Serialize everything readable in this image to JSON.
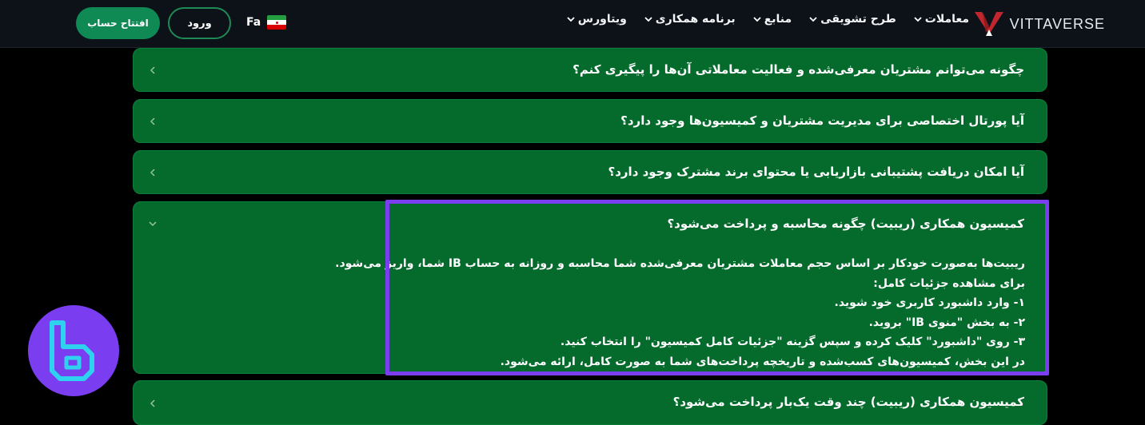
{
  "header": {
    "brand_name": "VITTAVERSE",
    "nav": [
      {
        "label": "معاملات"
      },
      {
        "label": "طرح تشویقی"
      },
      {
        "label": "منابع"
      },
      {
        "label": "برنامه همکاری"
      },
      {
        "label": "ویتاورس"
      }
    ],
    "language": "Fa",
    "login_label": "ورود",
    "open_account_label": "افتتاح حساب"
  },
  "faq": {
    "items": [
      {
        "question": "چگونه می‌توانم مشتریان معرفی‌شده و فعالیت معاملاتی آن‌ها را پیگیری کنم؟",
        "expanded": false
      },
      {
        "question": "آیا پورتال اختصاصی برای مدیریت مشتریان و کمیسیون‌ها وجود دارد؟",
        "expanded": false
      },
      {
        "question": "آیا امکان دریافت پشتیبانی بازاریابی یا محتوای برند مشترک وجود دارد؟",
        "expanded": false
      },
      {
        "question": "کمیسیون همکاری (ریبیت) چگونه محاسبه و پرداخت می‌شود؟",
        "expanded": true
      },
      {
        "question": "کمیسیون همکاری (ریبیت) چند وقت یک‌بار پرداخت می‌شود؟",
        "expanded": false
      }
    ],
    "answer_lines": [
      "ریبیت‌ها به‌صورت خودکار بر اساس حجم معاملات مشتریان معرفی‌شده شما محاسبه و روزانه به حساب IB شما، واریز می‌شود.",
      "برای مشاهده جزئیات کامل:",
      "۱- وارد داشبورد کاربری خود شوید.",
      "۲- به بخش \"منوی IB\" بروید.",
      "۳- روی \"داشبورد\" کلیک کرده و سپس گزینه \"جزئیات کامل کمیسیون\" را انتخاب کنید.",
      "در این بخش، کمیسیون‌های کسب‌شده و تاریخچه پرداخت‌های شما به صورت کامل، ارائه می‌شود."
    ]
  },
  "colors": {
    "accent_green": "#046b2d",
    "highlight_purple": "#7a3df0",
    "header_bg": "#0d1219",
    "brand_red": "#c0262d",
    "logo_cyan": "#2fd2ee"
  }
}
